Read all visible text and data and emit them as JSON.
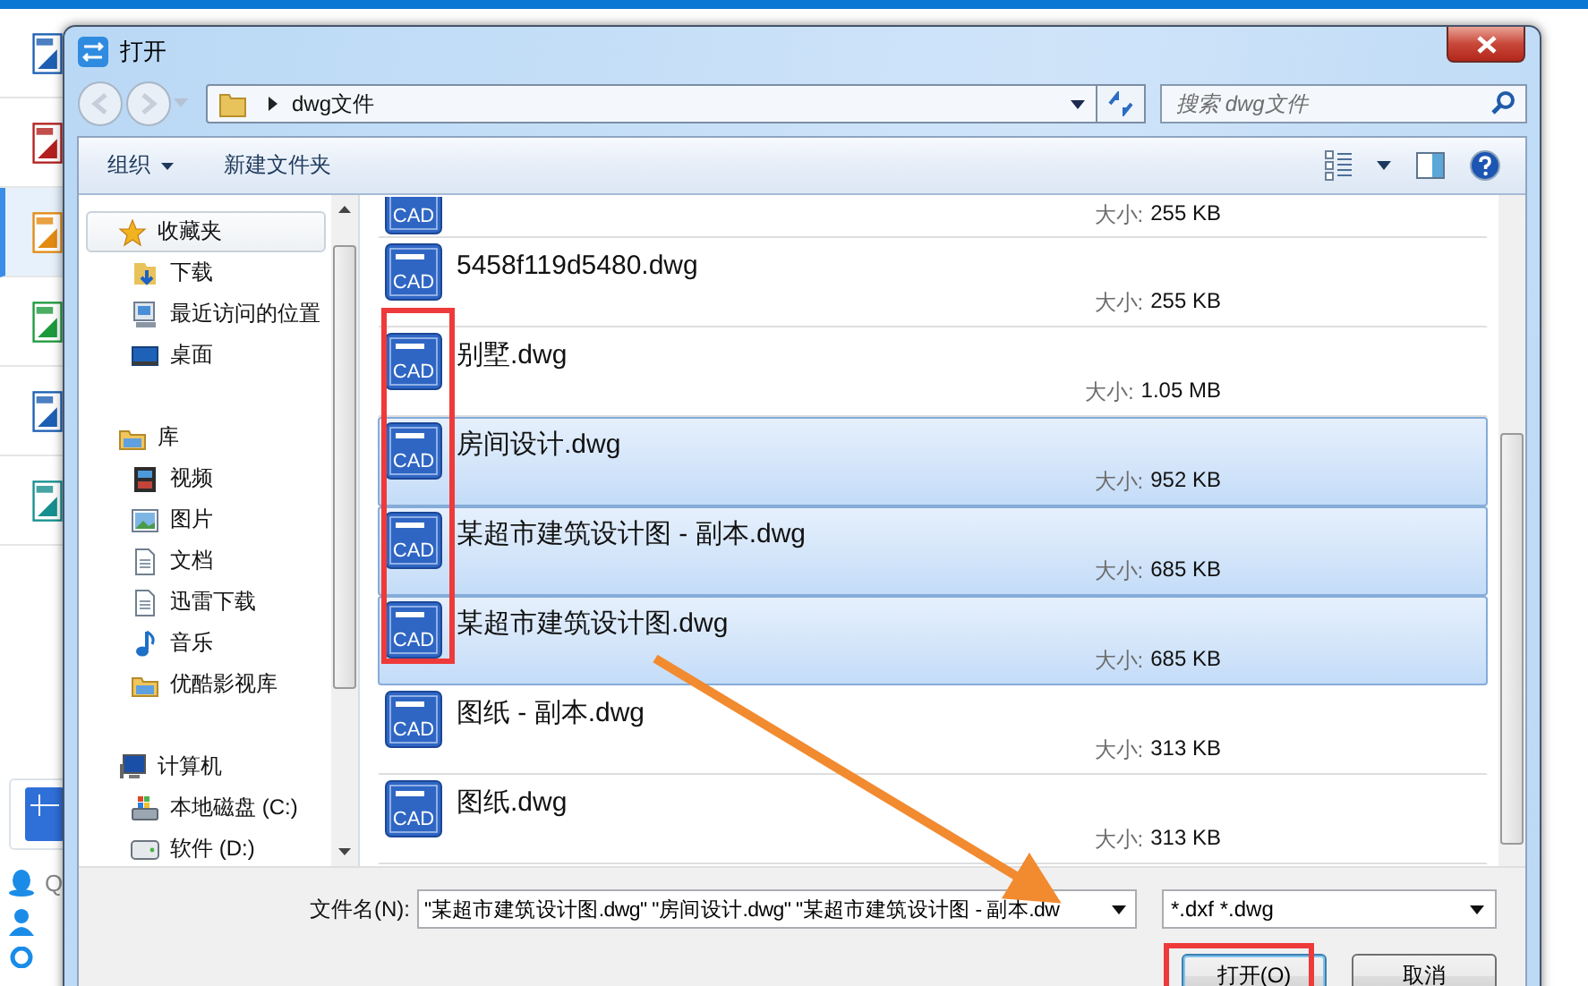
{
  "background_app": {
    "tiles": [
      {
        "kind": "blue",
        "selected": false
      },
      {
        "kind": "red",
        "selected": false
      },
      {
        "kind": "orange",
        "selected": true
      },
      {
        "kind": "green",
        "selected": false
      },
      {
        "kind": "blue",
        "selected": false
      },
      {
        "kind": "teal",
        "selected": false
      }
    ],
    "contact_letter": "Q"
  },
  "window": {
    "title": "打开"
  },
  "address": {
    "path": "dwg文件"
  },
  "search": {
    "placeholder": "搜索 dwg文件"
  },
  "toolbar": [
    {
      "label": "组织",
      "kind": "menu"
    },
    {
      "label": "新建文件夹",
      "kind": "button"
    }
  ],
  "nav": [
    {
      "label": "收藏夹",
      "kind": "star",
      "selected": true,
      "children": [
        {
          "label": "下载",
          "kind": "download",
          "selected": false
        },
        {
          "label": "最近访问的位置",
          "kind": "recent",
          "selected": false
        },
        {
          "label": "桌面",
          "kind": "desktop",
          "selected": false
        }
      ]
    },
    {
      "label": "库",
      "kind": "library",
      "selected": false,
      "children": [
        {
          "label": "视频",
          "kind": "video",
          "selected": false
        },
        {
          "label": "图片",
          "kind": "picture",
          "selected": false
        },
        {
          "label": "文档",
          "kind": "document",
          "selected": false
        },
        {
          "label": "迅雷下载",
          "kind": "document",
          "selected": false
        },
        {
          "label": "音乐",
          "kind": "music",
          "selected": false
        },
        {
          "label": "优酷影视库",
          "kind": "library",
          "selected": false
        }
      ]
    },
    {
      "label": "计算机",
      "kind": "computer",
      "selected": false,
      "children": [
        {
          "label": "本地磁盘 (C:)",
          "kind": "disk",
          "selected": false
        },
        {
          "label": "软件 (D:)",
          "kind": "drive",
          "selected": false
        }
      ]
    }
  ],
  "files": [
    {
      "kind": "partial",
      "icon_label": "CAD",
      "size_label": "大小:",
      "size": "255 KB",
      "selected": false
    },
    {
      "kind": "full",
      "name": "5458f119d5480.dwg",
      "icon_label": "CAD",
      "size_label": "大小:",
      "size": "255 KB",
      "selected": false
    },
    {
      "kind": "full",
      "name": "别墅.dwg",
      "icon_label": "CAD",
      "size_label": "大小:",
      "size": "1.05 MB",
      "selected": false
    },
    {
      "kind": "full",
      "name": "房间设计.dwg",
      "icon_label": "CAD",
      "size_label": "大小:",
      "size": "952 KB",
      "selected": true
    },
    {
      "kind": "full",
      "name": "某超市建筑设计图 - 副本.dwg",
      "icon_label": "CAD",
      "size_label": "大小:",
      "size": "685 KB",
      "selected": true
    },
    {
      "kind": "full",
      "name": "某超市建筑设计图.dwg",
      "icon_label": "CAD",
      "size_label": "大小:",
      "size": "685 KB",
      "selected": true
    },
    {
      "kind": "full",
      "name": "图纸 - 副本.dwg",
      "icon_label": "CAD",
      "size_label": "大小:",
      "size": "313 KB",
      "selected": false
    },
    {
      "kind": "full",
      "name": "图纸.dwg",
      "icon_label": "CAD",
      "size_label": "大小:",
      "size": "313 KB",
      "selected": false
    }
  ],
  "footer": {
    "filename_label": "文件名(N):",
    "filename_value": "\"某超市建筑设计图.dwg\" \"房间设计.dwg\" \"某超市建筑设计图 - 副本.dw",
    "filter": "*.dxf *.dwg",
    "buttons": [
      {
        "label": "打开(O)",
        "kind": "primary"
      },
      {
        "label": "取消",
        "kind": "normal"
      }
    ]
  }
}
